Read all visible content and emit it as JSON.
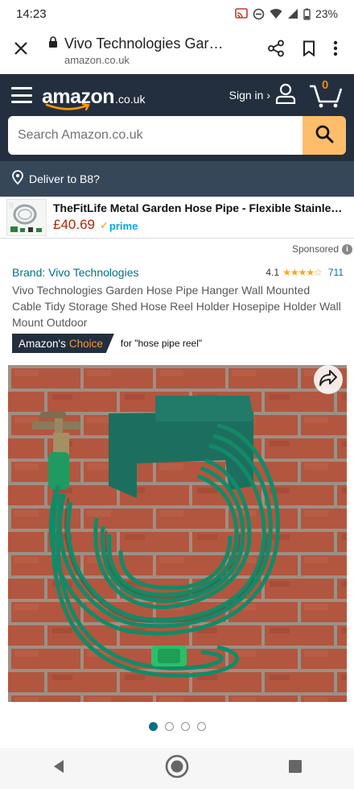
{
  "status_bar": {
    "time": "14:23",
    "battery": "23%",
    "icons": [
      "cast-icon",
      "dnd-icon",
      "wifi-icon",
      "signal-icon",
      "battery-icon"
    ]
  },
  "browser": {
    "title": "Vivo Technologies Garde...",
    "domain": "amazon.co.uk",
    "icons": [
      "close-icon",
      "lock-icon",
      "share-icon",
      "bookmark-icon",
      "more-vert-icon"
    ]
  },
  "header": {
    "logo_main": "amazon",
    "logo_tld": ".co.uk",
    "sign_in": "Sign in ›",
    "cart_count": "0",
    "search_placeholder": "Search Amazon.co.uk",
    "deliver_to": "Deliver to B8?"
  },
  "ad": {
    "title": "TheFitLife Metal Garden Hose Pipe - Flexible Stainless...",
    "price": "£40.69",
    "prime": "prime",
    "sponsored": "Sponsored"
  },
  "product": {
    "brand": "Brand: Vivo Technologies",
    "rating": "4.1",
    "stars": "★★★★☆",
    "rating_count": "711",
    "title": "Vivo Technologies Garden Hose Pipe Hanger Wall Mounted Cable Tidy Storage Shed Hose Reel Holder Hosepipe Holder Wall Mount Outdoor",
    "choice_prefix": "Amazon's",
    "choice_word": "Choice",
    "choice_for": "for \"hose pipe reel\""
  },
  "gallery": {
    "image_count": 4,
    "active_index": 0
  },
  "colors": {
    "header_bg": "#232f3e",
    "deliver_bg": "#37475a",
    "search_button": "#febd69",
    "link": "#007185",
    "price": "#b12704",
    "star": "#ffa41c",
    "choice_orange": "#f69931",
    "hose_green": "#0f8a6a"
  }
}
